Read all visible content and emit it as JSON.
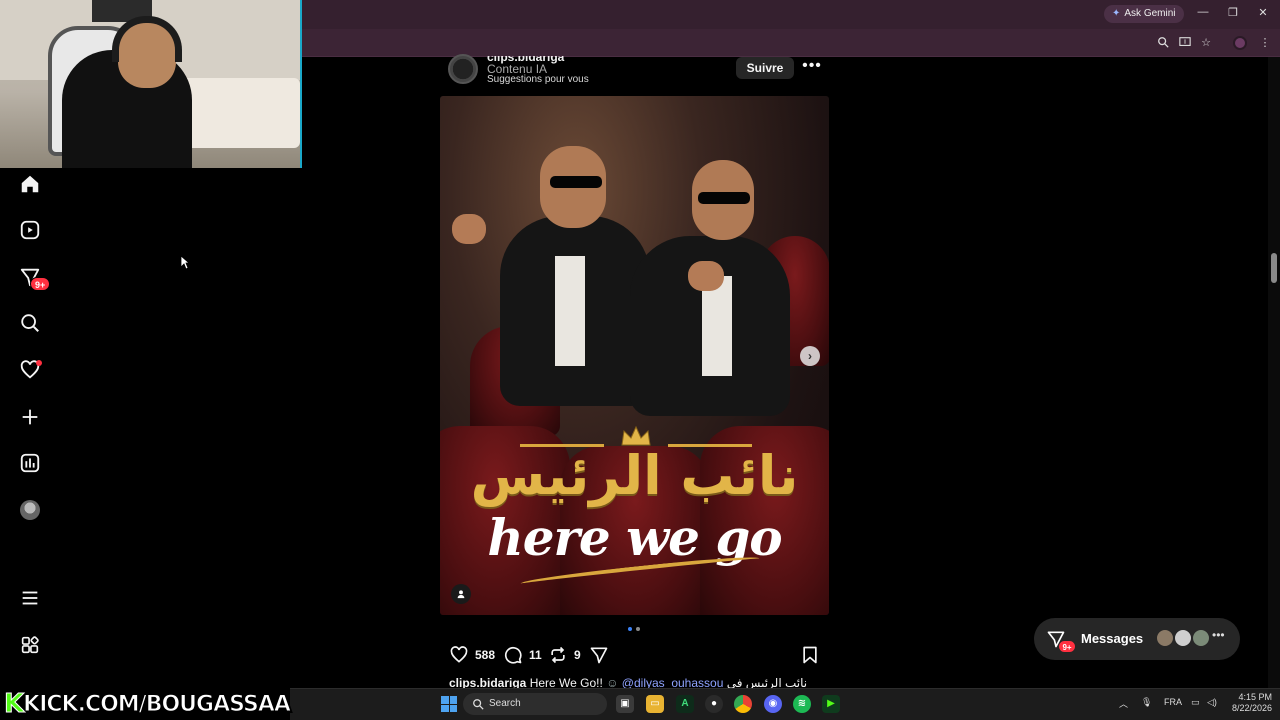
{
  "browser": {
    "ask_gemini": "Ask Gemini"
  },
  "post": {
    "username": "clips.bidariga",
    "subtitle": "Contenu IA",
    "suggestion": "Suggestions pour vous",
    "follow_label": "Suivre",
    "image_title_arabic": "نائب الرئيس",
    "image_title_english": "here we go",
    "carousel_count": 2,
    "carousel_active": 1,
    "likes": "588",
    "comments": "11",
    "reposts": "9",
    "caption_user": "clips.bidariga",
    "caption_text": "Here We Go!!",
    "caption_mention": "@dilyas_ouhassou",
    "caption_arabic": "نائب الرئيس في"
  },
  "sidebar": {
    "notification_badge": "9+"
  },
  "messages": {
    "label": "Messages",
    "badge": "9+"
  },
  "overlay": {
    "kick_k": "K",
    "kick_rest": "KICK.COM/BOUGASSAA"
  },
  "taskbar": {
    "search_placeholder": "Search",
    "language": "FRA",
    "time": "4:15 PM",
    "date": "8/22/2026"
  },
  "colors": {
    "accent_red": "#ff3040",
    "gold": "#e2b548",
    "kick_green": "#53fc18",
    "chrome_bg": "#35202f"
  }
}
